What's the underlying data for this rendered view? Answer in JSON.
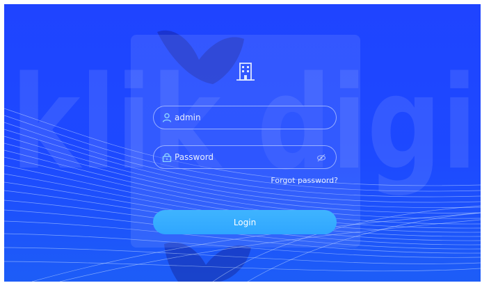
{
  "background": {
    "watermark_text": "klik digi"
  },
  "login_form": {
    "username_value": "admin",
    "password_placeholder": "Password",
    "forgot_label": "Forgot password?",
    "login_label": "Login"
  },
  "icons": {
    "logo": "building-icon",
    "username": "user-icon",
    "password": "lock-icon",
    "visibility": "eye-off-icon"
  },
  "colors": {
    "background": "#1f44ff",
    "login_button": "#35adff",
    "card": "#8fa6ff"
  }
}
